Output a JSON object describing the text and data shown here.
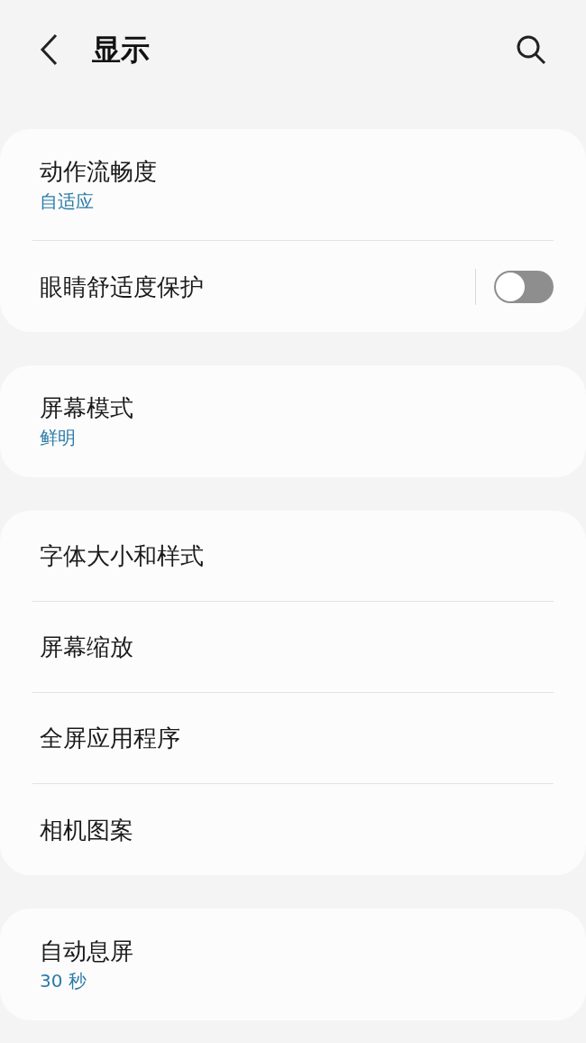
{
  "header": {
    "title": "显示"
  },
  "groups": [
    {
      "items": [
        {
          "kind": "link",
          "title": "动作流畅度",
          "subtitle": "自适应"
        },
        {
          "kind": "toggle",
          "title": "眼睛舒适度保护",
          "on": false
        }
      ]
    },
    {
      "items": [
        {
          "kind": "link",
          "title": "屏幕模式",
          "subtitle": "鲜明"
        }
      ]
    },
    {
      "items": [
        {
          "kind": "link",
          "title": "字体大小和样式"
        },
        {
          "kind": "link",
          "title": "屏幕缩放"
        },
        {
          "kind": "link",
          "title": "全屏应用程序"
        },
        {
          "kind": "link",
          "title": "相机图案"
        }
      ]
    },
    {
      "items": [
        {
          "kind": "link",
          "title": "自动息屏",
          "subtitle": "30 秒"
        }
      ]
    }
  ]
}
